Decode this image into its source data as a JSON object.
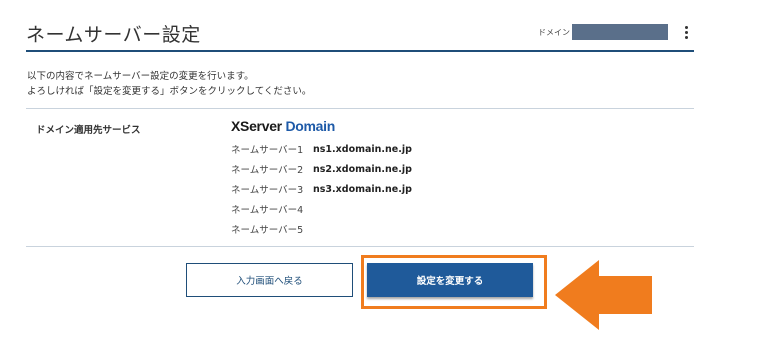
{
  "header": {
    "title": "ネームサーバー設定",
    "domain_label": "ドメイン"
  },
  "intro": {
    "line1": "以下の内容でネームサーバー設定の変更を行います。",
    "line2": "よろしければ「設定を変更する」ボタンをクリックしてください。"
  },
  "info": {
    "label": "ドメイン適用先サービス",
    "service_logo_part1": "XServer",
    "service_logo_part2": "Domain",
    "nameservers": [
      {
        "label": "ネームサーバー1",
        "value": "ns1.xdomain.ne.jp"
      },
      {
        "label": "ネームサーバー2",
        "value": "ns2.xdomain.ne.jp"
      },
      {
        "label": "ネームサーバー3",
        "value": "ns3.xdomain.ne.jp"
      },
      {
        "label": "ネームサーバー4",
        "value": ""
      },
      {
        "label": "ネームサーバー5",
        "value": ""
      }
    ]
  },
  "buttons": {
    "back_label": "入力画面へ戻る",
    "submit_label": "設定を変更する"
  },
  "colors": {
    "accent": "#1f4e79",
    "primary_button": "#1f5a9a",
    "highlight": "#f07c1e"
  },
  "icons": {
    "menu": "kebab-menu-icon",
    "pointer": "arrow-left-icon"
  }
}
